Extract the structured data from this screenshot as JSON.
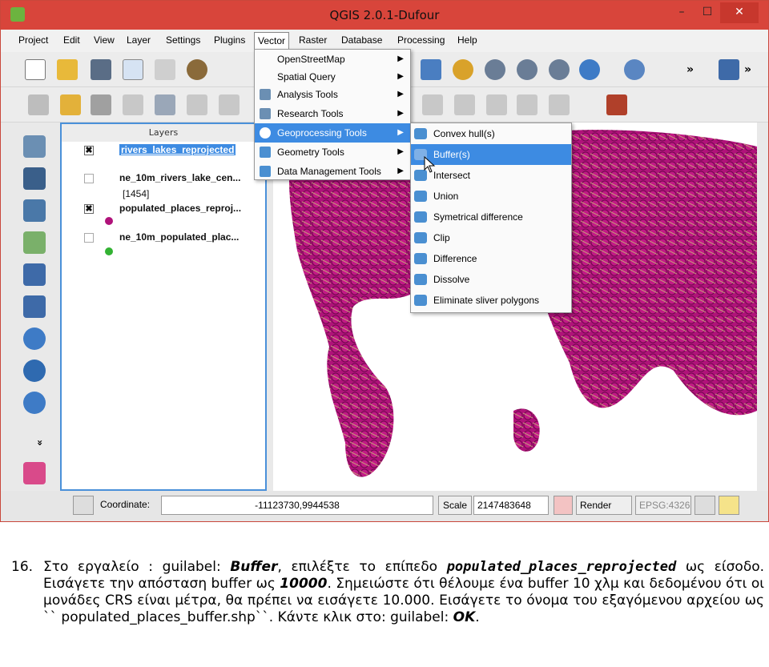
{
  "window": {
    "title": "QGIS 2.0.1-Dufour",
    "min_label": "–",
    "max_label": "☐",
    "close_label": "✕"
  },
  "menubar": [
    "Project",
    "Edit",
    "View",
    "Layer",
    "Settings",
    "Plugins",
    "Vector",
    "Raster",
    "Database",
    "Processing",
    "Help"
  ],
  "vector_menu": [
    {
      "label": "OpenStreetMap",
      "submenu": true
    },
    {
      "label": "Spatial Query",
      "submenu": true
    },
    {
      "label": "Analysis Tools",
      "submenu": true
    },
    {
      "label": "Research Tools",
      "submenu": true
    },
    {
      "label": "Geoprocessing Tools",
      "submenu": true,
      "highlighted": true
    },
    {
      "label": "Geometry Tools",
      "submenu": true
    },
    {
      "label": "Data Management Tools",
      "submenu": true
    }
  ],
  "geoprocessing_menu": [
    {
      "label": "Convex hull(s)"
    },
    {
      "label": "Buffer(s)",
      "highlighted": true
    },
    {
      "label": "Intersect"
    },
    {
      "label": "Union"
    },
    {
      "label": "Symetrical difference"
    },
    {
      "label": "Clip"
    },
    {
      "label": "Difference"
    },
    {
      "label": "Dissolve"
    },
    {
      "label": "Eliminate sliver polygons"
    }
  ],
  "layers_panel": {
    "title": "Layers",
    "layers": [
      {
        "name": "rivers_lakes_reprojected",
        "checked": true,
        "selected": true
      },
      {
        "name": "ne_10m_rivers_lake_cen...",
        "checked": false,
        "count": "[1454]"
      },
      {
        "name": "populated_places_reproj...",
        "checked": true
      },
      {
        "name": "ne_10m_populated_plac...",
        "checked": false
      }
    ]
  },
  "statusbar": {
    "coordinate_label": "Coordinate:",
    "coordinate_value": "-11123730,9944538",
    "scale_label": "Scale",
    "scale_value": "2147483648",
    "render_label": "Render",
    "crs_label": "EPSG:4326"
  },
  "toolbar_overflow": "»",
  "left_tools_more": "»",
  "caption": {
    "number": "16.",
    "p1": "Στο εργαλείο : guilabel: ",
    "buffer": "Buffer",
    "p2": ", επιλέξτε το επίπεδο ",
    "layer": "populated_places_reprojected",
    "p3": " ως είσοδο. Εισάγετε την απόσταση buffer ως ",
    "dist": "10000",
    "p4": ". Σημειώστε ότι θέλουμε ένα buffer 10 χλμ και δεδομένου ότι οι μονάδες CRS είναι μέτρα, θα πρέπει να εισάγετε 10.000. Εισάγετε το όνομα του εξαγόμενου αρχείου ως `` populated_places_buffer.shp``. Κάντε κλικ στο: guilabel: ",
    "ok": "OK",
    "p5": "."
  },
  "colors": {
    "titlebar": "#d8453b",
    "highlight": "#3d8be2",
    "points": "#b0127a",
    "rivers": "#c4a07a"
  }
}
